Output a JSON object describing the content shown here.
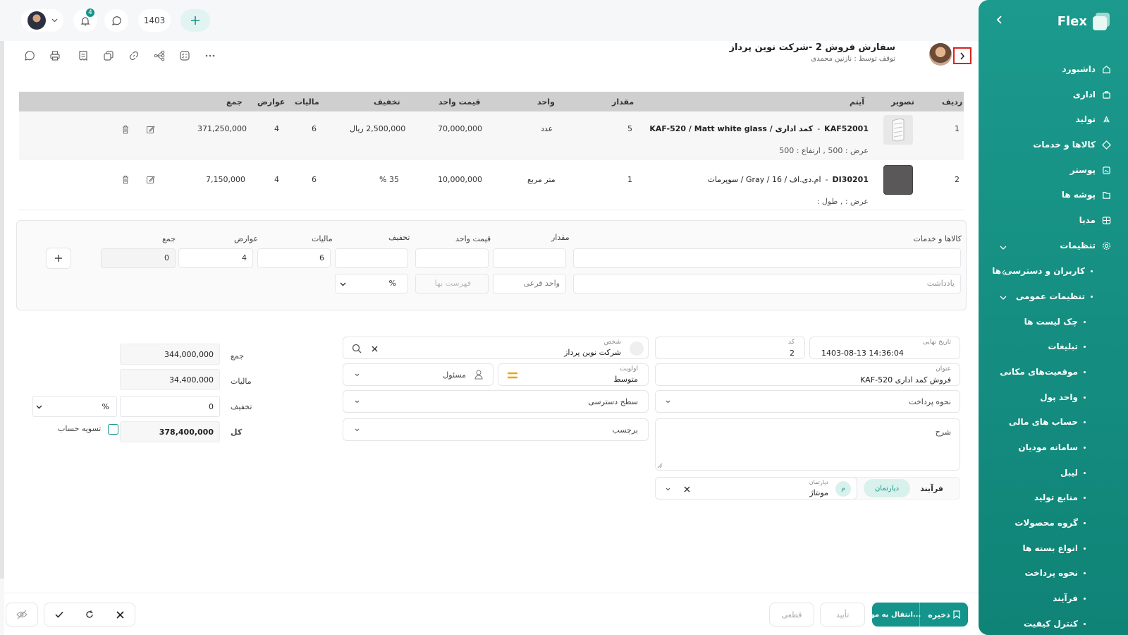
{
  "sidebar": {
    "brand": "Flex",
    "items": [
      {
        "label": "داشبورد",
        "icon": "home-icon"
      },
      {
        "label": "اداری",
        "icon": "briefcase-icon"
      },
      {
        "label": "تولید",
        "icon": "factory-icon"
      },
      {
        "label": "کالاها و خدمات",
        "icon": "box-icon"
      },
      {
        "label": "پوستر",
        "icon": "poster-icon"
      },
      {
        "label": "پوشه ها",
        "icon": "folder-icon"
      },
      {
        "label": "مدیا",
        "icon": "media-icon"
      },
      {
        "label": "تنظیمات",
        "icon": "gear-icon"
      }
    ],
    "sub_items": [
      "کاربران و دسترسی ها",
      "تنظیمات عمومی",
      "چک لیست ها",
      "تبلیغات",
      "موقعیت‌های مکانی",
      "واحد پول",
      "حساب های مالی",
      "سامانه مودیان",
      "لیبل",
      "منابع تولید",
      "گروه محصولات",
      "انواع بسته ها",
      "نحوه پرداخت",
      "فرآیند",
      "کنترل کیفیت"
    ]
  },
  "topbar": {
    "year": "1403",
    "notification_count": "4"
  },
  "header": {
    "title": "سفارش فروش 2 -شرکت نوین پرداز",
    "subtitle": "توقف توسط : نازنین محمدی"
  },
  "table": {
    "headers": [
      "ردیف",
      "تصویر",
      "آیتم",
      "مقدار",
      "واحد",
      "قیمت واحد",
      "تخفیف",
      "مالیات",
      "عوارض",
      "جمع"
    ],
    "rows": [
      {
        "index": "1",
        "code": "KAF52001",
        "name": "کمد اداری / KAF-520 / Matt white glass",
        "details": "عرض : 500 ,  ارتفاع : 500",
        "qty": "5",
        "unit": "عدد",
        "unit_price": "70,000,000",
        "discount": "2,500,000 ریال",
        "tax": "6",
        "duty": "4",
        "total": "371,250,000"
      },
      {
        "index": "2",
        "code": "DI30201",
        "name": "ام.دی.اف / 16 / Gray / سوپرمات",
        "details": "عرض : ,  طول :",
        "qty": "1",
        "unit": "متر مربع",
        "unit_price": "10,000,000",
        "discount": "35 %",
        "tax": "6",
        "duty": "4",
        "total": "7,150,000"
      }
    ]
  },
  "add_item": {
    "labels": {
      "goods": "کالاها و خدمات",
      "qty": "مقدار",
      "unit_price": "قیمت واحد",
      "discount": "تخفیف",
      "tax": "مالیات",
      "duty": "عوارض",
      "total": "جمع"
    },
    "tax_value": "6",
    "duty_value": "4",
    "total_value": "0",
    "note_placeholder": "یادداشت",
    "sub_unit_placeholder": "واحد فرعی",
    "price_list_placeholder": "فهرست بها",
    "discount_type": "%"
  },
  "form": {
    "due_date_label": "تاریخ نهایی",
    "due_date": "1403-08-13 14:36:04",
    "code_label": "کد",
    "code": "2",
    "person_label": "شخص",
    "person": "شرکت نوین پرداز",
    "title_label": "عنوان",
    "title": "فروش کمد اداری KAF-520",
    "priority_label": "اولویت",
    "priority": "متوسط",
    "responsible": "مسئول",
    "payment_method": "نحوه پرداخت",
    "access_level": "سطح دسترسی",
    "description": "شرح",
    "tag": "برچسب",
    "process_label": "فرآیند",
    "department_tab": "دپارتمان",
    "department_label": "دپارتمان",
    "department": "مونتاژ",
    "department_avatar": "م"
  },
  "summary": {
    "sum_label": "جمع",
    "sum": "344,000,000",
    "tax_label": "مالیات",
    "tax": "34,400,000",
    "discount_label": "تخفیف",
    "discount": "0",
    "discount_type": "%",
    "total_label": "کل",
    "total": "378,400,000",
    "settle_label": "تسویه حساب"
  },
  "footer": {
    "save": "ذخیره",
    "transfer": "انتقال به مو...",
    "confirm": "تأیید",
    "final": "قطعی"
  },
  "colors": {
    "primary": "#14948a",
    "highlight": "#e02020"
  }
}
